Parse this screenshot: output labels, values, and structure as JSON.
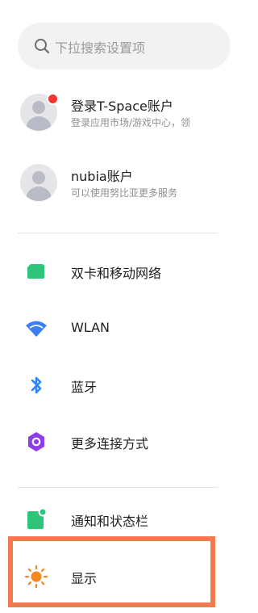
{
  "search": {
    "placeholder": "下拉搜索设置项",
    "icon": "search-icon"
  },
  "accounts": [
    {
      "title": "登录T-Space账户",
      "subtitle": "登录应用市场/游戏中心，领",
      "has_badge": true
    },
    {
      "title": "nubia账户",
      "subtitle": "可以使用努比亚更多服务",
      "has_badge": false
    }
  ],
  "settings": [
    {
      "label": "双卡和移动网络",
      "icon": "sim-card-icon",
      "color": "#2ec57a"
    },
    {
      "label": "WLAN",
      "icon": "wifi-icon",
      "color": "#3d7df5"
    },
    {
      "label": "蓝牙",
      "icon": "bluetooth-icon",
      "color": "#2f86f7"
    },
    {
      "label": "更多连接方式",
      "icon": "connection-hexagon-icon",
      "color": "#8e3ee6"
    },
    {
      "label": "通知和状态栏",
      "icon": "notification-icon",
      "color": "#2ec57a"
    },
    {
      "label": "显示",
      "icon": "brightness-sun-icon",
      "color": "#f5871f"
    }
  ],
  "colors": {
    "highlight": "#f47a4e",
    "badge": "#f0362f"
  }
}
